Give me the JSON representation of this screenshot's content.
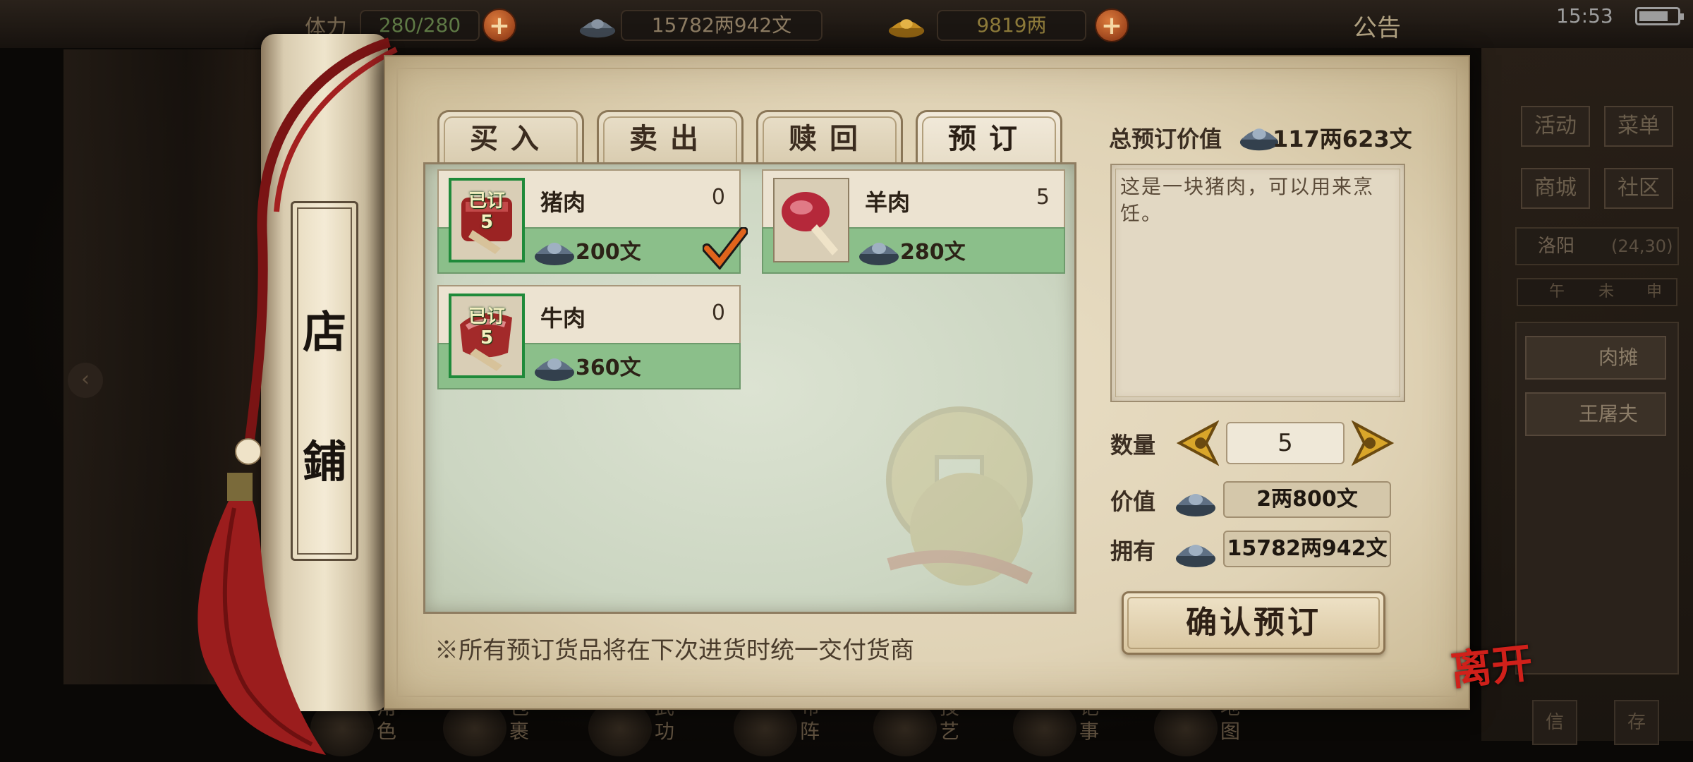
{
  "topbar": {
    "stamina_label": "体力",
    "stamina": "280/280",
    "silver": "15782两942文",
    "gold": "9819两",
    "notice": "公告",
    "clock": "15:53"
  },
  "roller": {
    "title_top": "店",
    "title_bottom": "鋪"
  },
  "tabs": [
    {
      "label": "买入"
    },
    {
      "label": "卖出"
    },
    {
      "label": "赎回"
    },
    {
      "label": "预订"
    }
  ],
  "active_tab": "预订",
  "items": [
    {
      "name": "猪肉",
      "count": "0",
      "price": "200文",
      "ordered_label": "已订",
      "ordered_qty": "5",
      "selected": true,
      "icon": "pork-icon"
    },
    {
      "name": "羊肉",
      "count": "5",
      "price": "280文",
      "ordered_label": "",
      "ordered_qty": "",
      "selected": false,
      "icon": "mutton-icon"
    },
    {
      "name": "牛肉",
      "count": "0",
      "price": "360文",
      "ordered_label": "已订",
      "ordered_qty": "5",
      "selected": false,
      "icon": "beef-icon"
    }
  ],
  "footnote": "※所有预订货品将在下次进货时统一交付货商",
  "summary": {
    "total_label": "总预订价值",
    "total_value": "117两623文",
    "description": "这是一块猪肉，可以用来烹饪。",
    "qty_label": "数量",
    "qty": "5",
    "value_label": "价值",
    "value": "2两800文",
    "own_label": "拥有",
    "own": "15782两942文",
    "confirm": "确认预订"
  },
  "leave": "离开",
  "side": {
    "buttons": [
      "活动",
      "菜单",
      "商城",
      "社区"
    ],
    "location": "洛阳",
    "coords": "(24,30)",
    "time_marks": [
      "午",
      "未",
      "申"
    ],
    "npcs": [
      "肉摊",
      "王屠夫"
    ],
    "small": [
      "信",
      "存"
    ]
  },
  "bottom_nav": [
    {
      "label": "角色",
      "icon": "character-icon"
    },
    {
      "label": "包裹",
      "icon": "bag-icon"
    },
    {
      "label": "武功",
      "icon": "martial-arts-icon"
    },
    {
      "label": "布阵",
      "icon": "formation-icon"
    },
    {
      "label": "技艺",
      "icon": "skill-icon"
    },
    {
      "label": "记事",
      "icon": "journal-icon"
    },
    {
      "label": "地图",
      "icon": "map-icon"
    }
  ],
  "colors": {
    "accent_red": "#d0201a",
    "card_green": "#8bbf8a",
    "ordered_border": "#1f8a3a",
    "parchment": "#e0d3b6"
  }
}
